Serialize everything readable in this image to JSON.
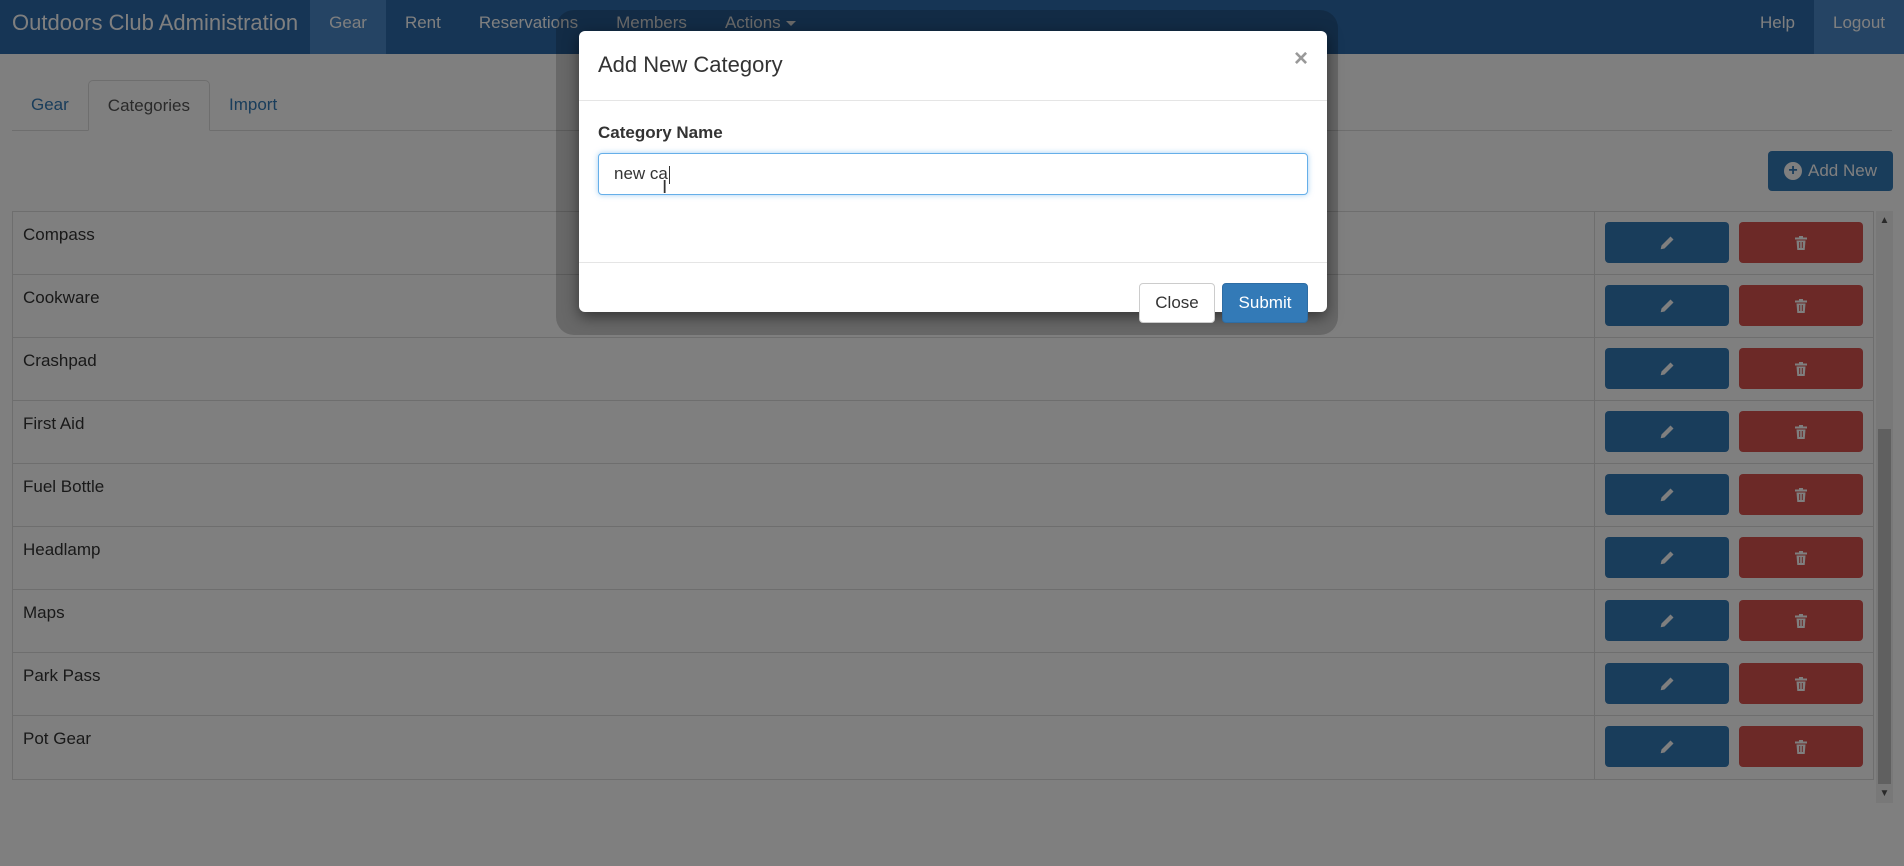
{
  "navbar": {
    "brand": "Outdoors Club Administration",
    "items": [
      {
        "label": "Gear",
        "active": true
      },
      {
        "label": "Rent"
      },
      {
        "label": "Reservations"
      },
      {
        "label": "Members"
      },
      {
        "label": "Actions"
      }
    ],
    "right": [
      {
        "label": "Help"
      },
      {
        "label": "Logout",
        "active": true
      }
    ]
  },
  "tabs": [
    {
      "label": "Gear"
    },
    {
      "label": "Categories",
      "active": true
    },
    {
      "label": "Import"
    }
  ],
  "toolbar": {
    "add_new_label": "Add New"
  },
  "categories": [
    {
      "name": "Compass"
    },
    {
      "name": "Cookware"
    },
    {
      "name": "Crashpad"
    },
    {
      "name": "First Aid"
    },
    {
      "name": "Fuel Bottle"
    },
    {
      "name": "Headlamp"
    },
    {
      "name": "Maps"
    },
    {
      "name": "Park Pass"
    },
    {
      "name": "Pot Gear"
    }
  ],
  "modal": {
    "title": "Add New Category",
    "close_glyph": "×",
    "field_label": "Category Name",
    "field_value": "new ca",
    "close_label": "Close",
    "submit_label": "Submit"
  },
  "colors": {
    "navbar": "#2d6aaa",
    "primary": "#337ab7",
    "danger": "#d9534f"
  }
}
